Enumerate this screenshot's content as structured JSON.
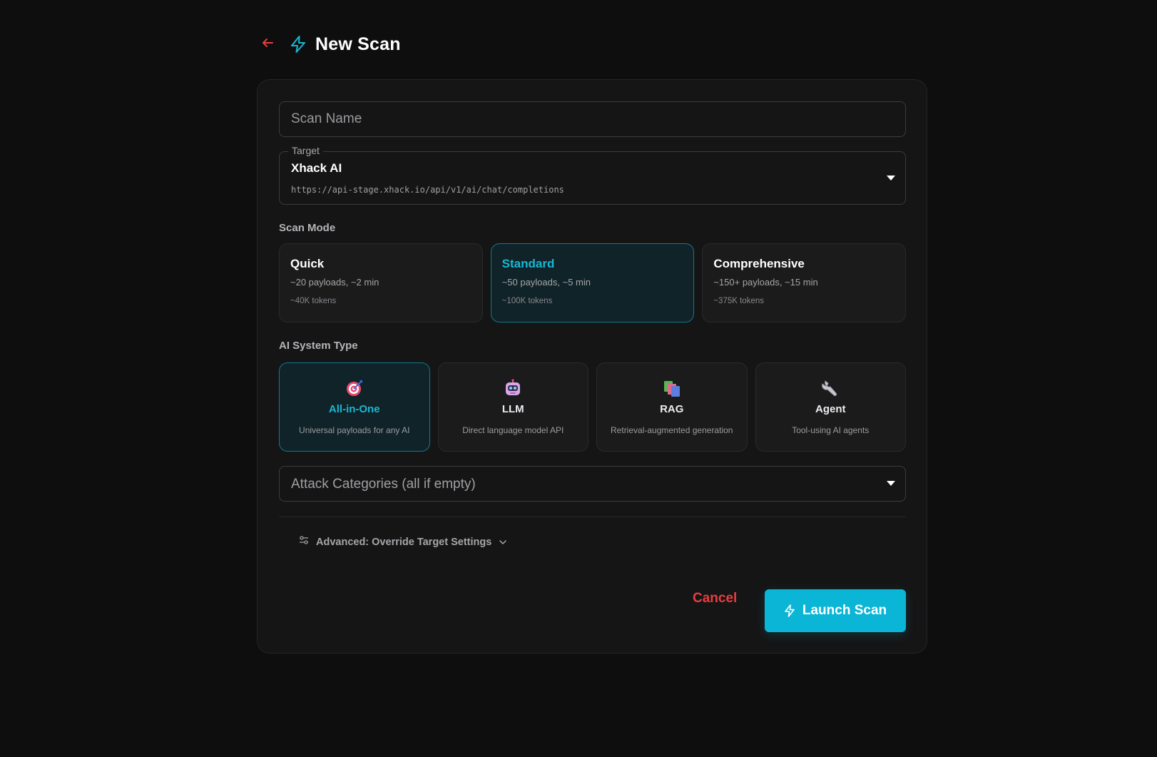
{
  "header": {
    "title": "New Scan",
    "back_icon": "arrow-left-icon",
    "title_icon": "bolt-icon"
  },
  "form": {
    "scan_name": {
      "placeholder": "Scan Name",
      "value": ""
    },
    "target": {
      "label": "Target",
      "name": "Xhack AI",
      "url": "https://api-stage.xhack.io/api/v1/ai/chat/completions"
    },
    "scan_mode": {
      "label": "Scan Mode",
      "selected": "Standard",
      "options": [
        {
          "title": "Quick",
          "desc": "~20 payloads, ~2 min",
          "tokens": "~40K tokens"
        },
        {
          "title": "Standard",
          "desc": "~50 payloads, ~5 min",
          "tokens": "~100K tokens"
        },
        {
          "title": "Comprehensive",
          "desc": "~150+ payloads, ~15 min",
          "tokens": "~375K tokens"
        }
      ]
    },
    "system_type": {
      "label": "AI System Type",
      "selected": "All-in-One",
      "options": [
        {
          "title": "All-in-One",
          "desc": "Universal payloads for any AI",
          "icon": "target-icon"
        },
        {
          "title": "LLM",
          "desc": "Direct language model API",
          "icon": "robot-icon"
        },
        {
          "title": "RAG",
          "desc": "Retrieval-augmented generation",
          "icon": "books-icon"
        },
        {
          "title": "Agent",
          "desc": "Tool-using AI agents",
          "icon": "wrench-icon"
        }
      ]
    },
    "attack_categories": {
      "placeholder": "Attack Categories (all if empty)"
    },
    "advanced": {
      "label": "Advanced: Override Target Settings",
      "icon": "sliders-icon"
    }
  },
  "actions": {
    "cancel_label": "Cancel",
    "launch_label": "Launch Scan"
  },
  "colors": {
    "background": "#0e0e0f",
    "card": "#151516",
    "accent": "#0bb5d6",
    "selected_text": "#18b8d4",
    "cancel": "#e53e3e"
  }
}
